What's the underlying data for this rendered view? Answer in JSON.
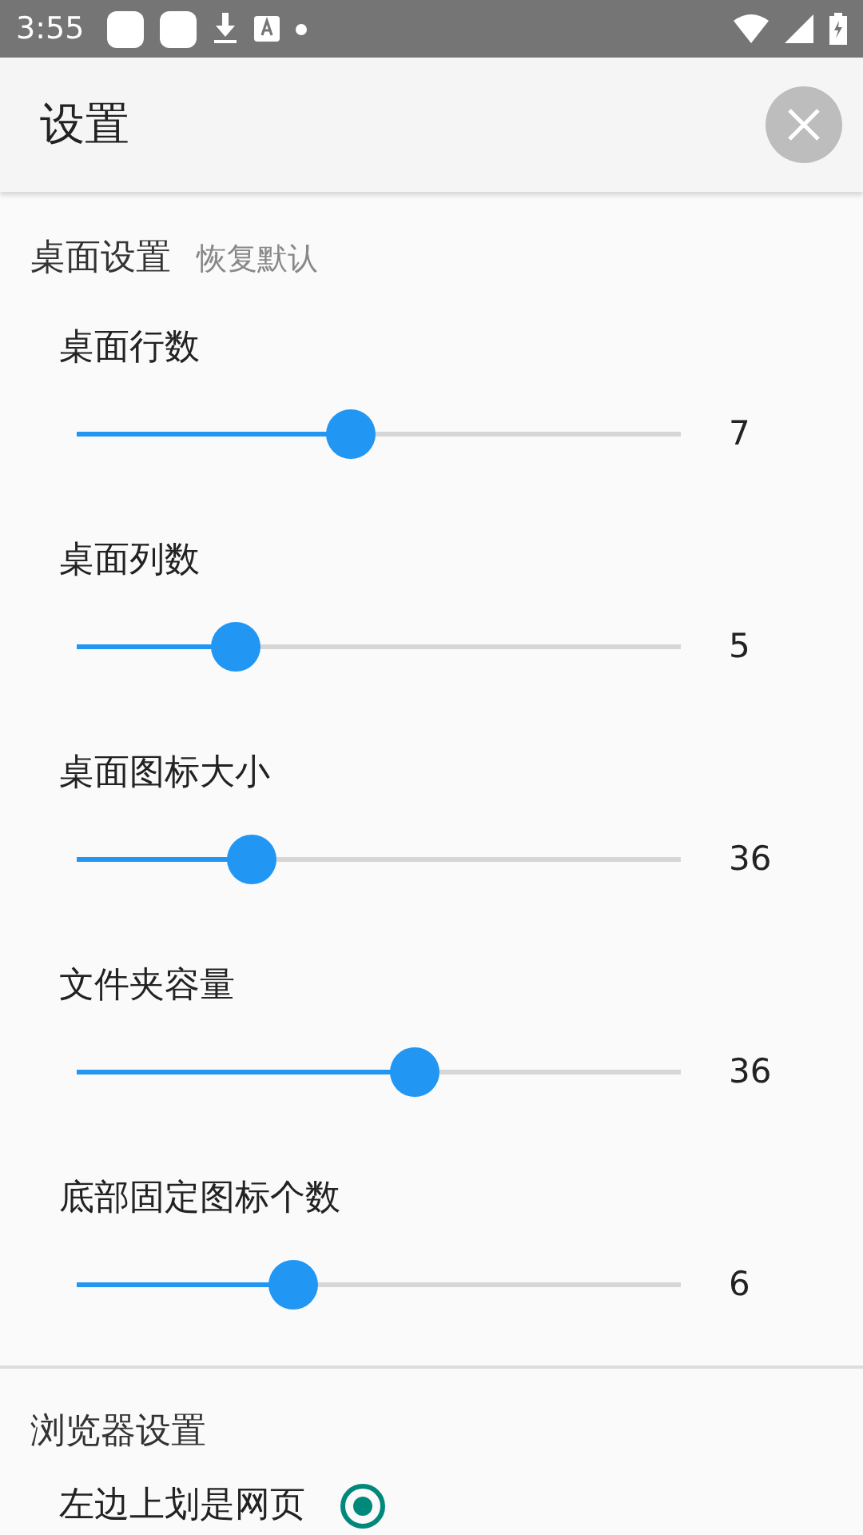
{
  "status_bar": {
    "time": "3:55"
  },
  "header": {
    "title": "设置"
  },
  "desktop_section": {
    "title": "桌面设置",
    "reset_link": "恢复默认",
    "sliders": [
      {
        "label": "桌面行数",
        "level": 0.45,
        "reading": "7"
      },
      {
        "label": "桌面列数",
        "level": 0.243,
        "reading": "5"
      },
      {
        "label": "桌面图标大小",
        "level": 0.27,
        "reading": "36"
      },
      {
        "label": "文件夹容量",
        "level": 0.566,
        "reading": "36"
      },
      {
        "label": "底部固定图标个数",
        "level": 0.347,
        "reading": "6"
      }
    ]
  },
  "browser_section": {
    "title": "浏览器设置",
    "options": [
      {
        "label": "左边上划是网页",
        "selected": true
      }
    ]
  }
}
